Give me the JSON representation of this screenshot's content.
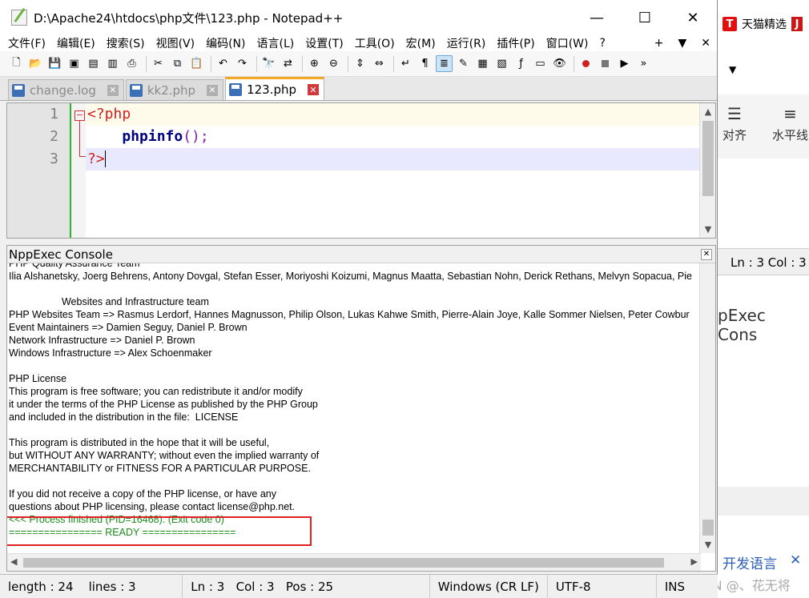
{
  "window": {
    "title": "D:\\Apache24\\htdocs\\php文件\\123.php - Notepad++",
    "minimize": "—",
    "maximize": "☐",
    "close": "✕"
  },
  "menu": [
    "文件(F)",
    "编辑(E)",
    "搜索(S)",
    "视图(V)",
    "编码(N)",
    "语言(L)",
    "设置(T)",
    "工具(O)",
    "宏(M)",
    "运行(R)",
    "插件(P)",
    "窗口(W)",
    "?"
  ],
  "menu_right": [
    "+",
    "▼",
    "✕"
  ],
  "tabs": [
    {
      "label": "change.log",
      "active": false
    },
    {
      "label": "kk2.php",
      "active": false
    },
    {
      "label": "123.php",
      "active": true
    }
  ],
  "editor": {
    "line_numbers": [
      "1",
      "2",
      "3"
    ],
    "line1": "<?php",
    "line2_indent": "    ",
    "line2_fn": "phpinfo",
    "line2_paren": "()",
    "line2_semi": ";",
    "line3": "?>"
  },
  "console": {
    "title": "NppExec Console",
    "close": "✕",
    "lines": [
      "PHP Quality Assurance Team",
      "Ilia Alshanetsky, Joerg Behrens, Antony Dovgal, Stefan Esser, Moriyoshi Koizumi, Magnus Maatta, Sebastian Nohn, Derick Rethans, Melvyn Sopacua, Pie",
      "",
      "                   Websites and Infrastructure team",
      "PHP Websites Team => Rasmus Lerdorf, Hannes Magnusson, Philip Olson, Lukas Kahwe Smith, Pierre-Alain Joye, Kalle Sommer Nielsen, Peter Cowbur",
      "Event Maintainers => Damien Seguy, Daniel P. Brown",
      "Network Infrastructure => Daniel P. Brown",
      "Windows Infrastructure => Alex Schoenmaker",
      "",
      "PHP License",
      "This program is free software; you can redistribute it and/or modify",
      "it under the terms of the PHP License as published by the PHP Group",
      "and included in the distribution in the file:  LICENSE",
      "",
      "This program is distributed in the hope that it will be useful,",
      "but WITHOUT ANY WARRANTY; without even the implied warranty of",
      "MERCHANTABILITY or FITNESS FOR A PARTICULAR PURPOSE.",
      "",
      "If you did not receive a copy of the PHP license, or have any",
      "questions about PHP licensing, please contact license@php.net."
    ],
    "finished": "<<< Process finished (PID=16468). (Exit code 0)",
    "ready": "================ READY ================"
  },
  "status": {
    "length": "length : 24",
    "lines": "lines : 3",
    "ln": "Ln : 3",
    "col": "Col : 3",
    "pos": "Pos : 25",
    "eol": "Windows (CR LF)",
    "encoding": "UTF-8",
    "mode": "INS"
  },
  "background": {
    "brand": "天猫精选",
    "tool1": "对齐",
    "tool2": "水平线",
    "ln_col": "Ln : 3   Col : 3",
    "console_label": "pExec Cons",
    "lang_tab": "开发语言",
    "lang_close": "✕",
    "watermark": "CSDN @、花无将"
  },
  "colors": {
    "php_tag": "#d02020",
    "function": "#000080",
    "paren": "#8020a0",
    "console_green": "#1a8a1a",
    "highlight_box": "#e02020",
    "active_tab_accent": "#f5a623"
  }
}
